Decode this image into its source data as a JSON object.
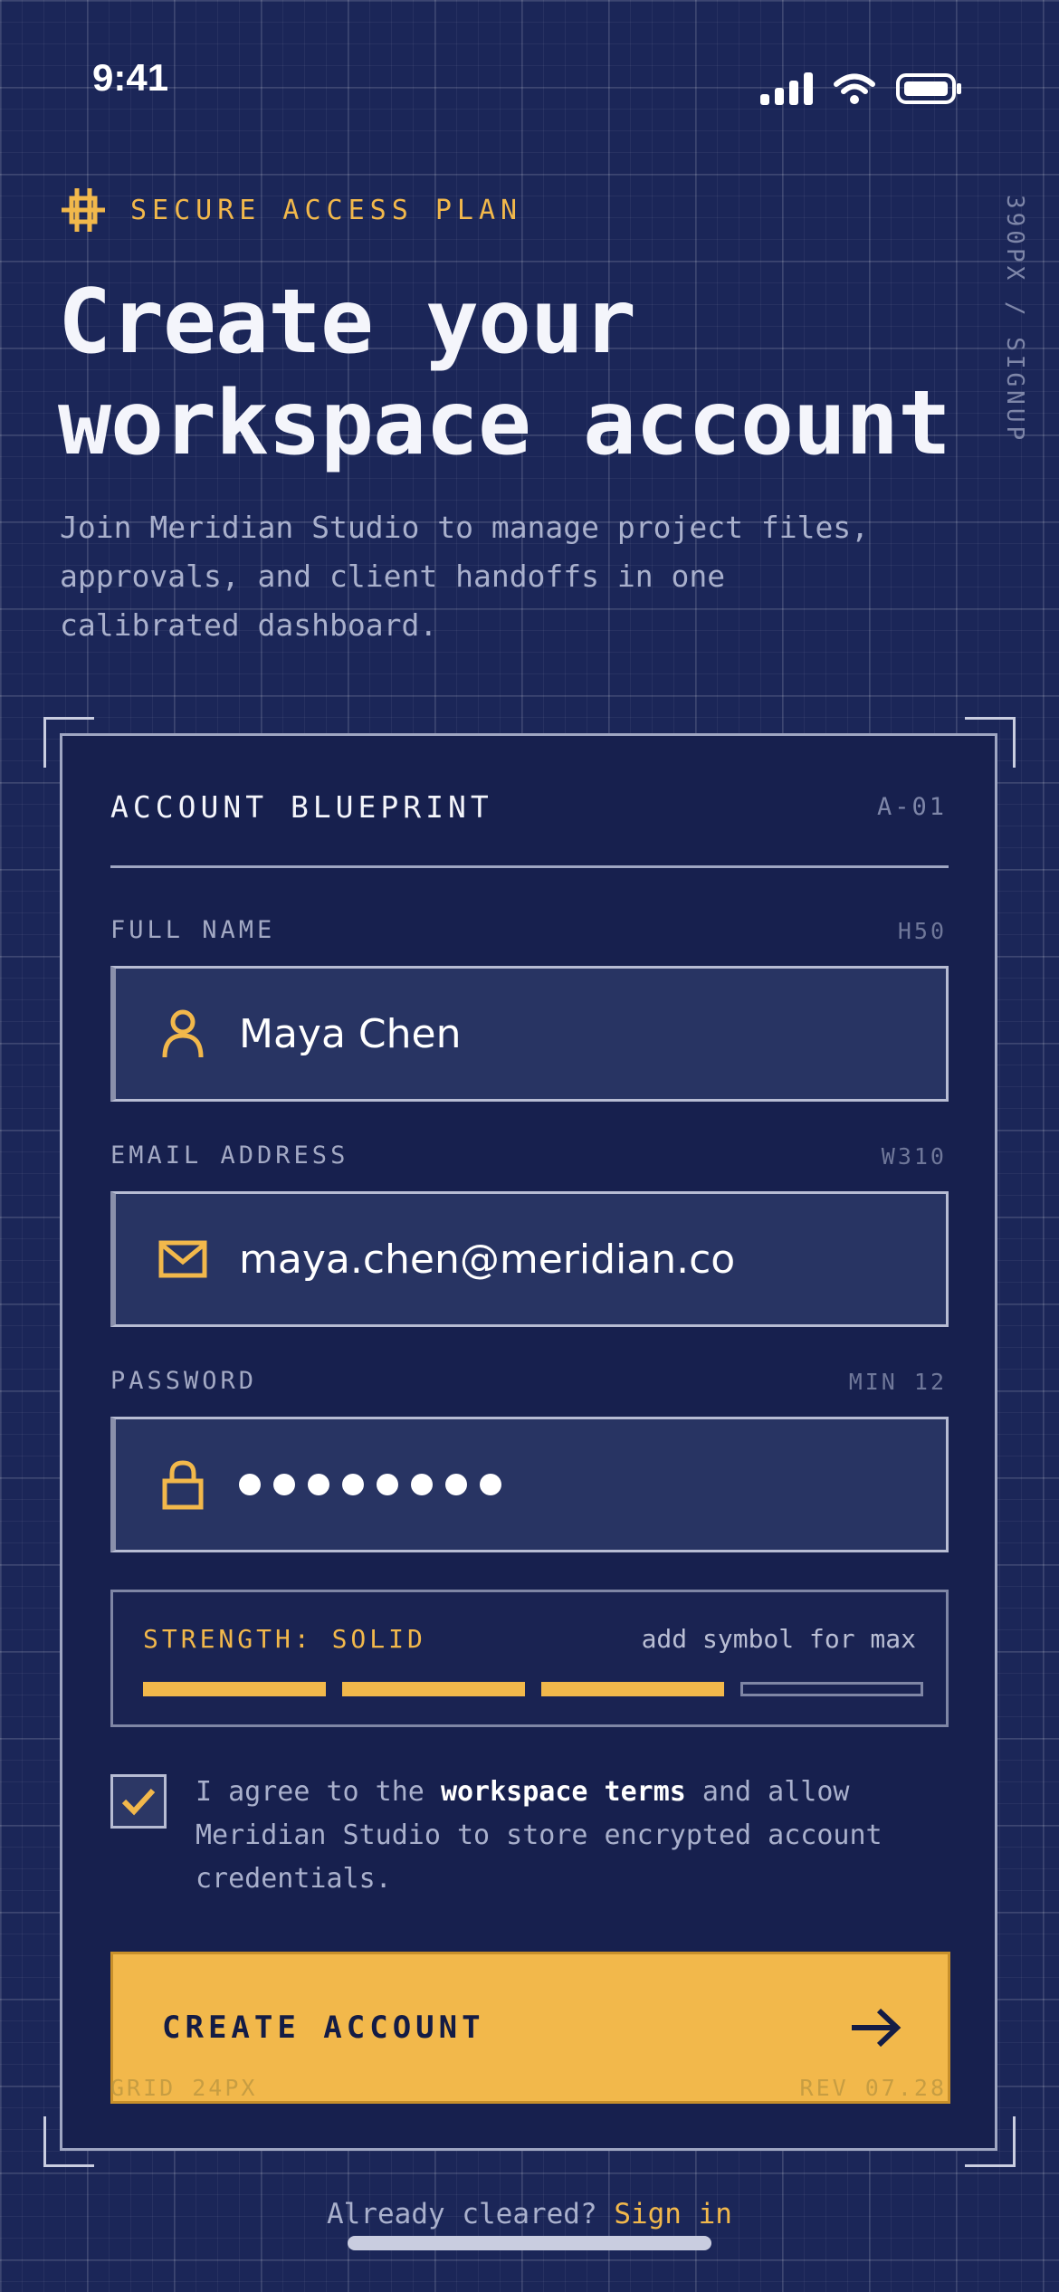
{
  "status_bar": {
    "time": "9:41"
  },
  "hero": {
    "eyebrow": "SECURE ACCESS PLAN",
    "title_line1": "Create your",
    "title_line2": "workspace account",
    "subtitle": "Join Meridian Studio to manage project files, approvals, and client handoffs in one calibrated dashboard.",
    "side_label": "390PX / SIGNUP"
  },
  "card": {
    "heading": "ACCOUNT BLUEPRINT",
    "code": "A-01",
    "fields": {
      "name": {
        "label": "FULL NAME",
        "spec": "H50",
        "value": "Maya Chen",
        "icon": "user-icon"
      },
      "email": {
        "label": "EMAIL ADDRESS",
        "spec": "W310",
        "value": "maya.chen@meridian.co",
        "icon": "mail-icon"
      },
      "password": {
        "label": "PASSWORD",
        "spec": "MIN 12",
        "masked_length": 8,
        "icon": "lock-icon"
      }
    },
    "strength": {
      "label": "STRENGTH: SOLID",
      "hint": "add symbol for max",
      "filled_segments": 3,
      "total_segments": 4
    },
    "terms": {
      "checked": true,
      "text_before": "I agree to the ",
      "link_text": "workspace terms",
      "text_after": " and allow Meridian Studio to store encrypted account credentials."
    },
    "cta_label": "CREATE ACCOUNT",
    "meta_left": "GRID 24PX",
    "meta_right": "REV 07.28"
  },
  "footer": {
    "prompt": "Already cleared?",
    "link": "Sign in"
  },
  "colors": {
    "background": "#1b2658",
    "accent": "#f2b84b",
    "card": "#17204e",
    "field": "#283463"
  }
}
